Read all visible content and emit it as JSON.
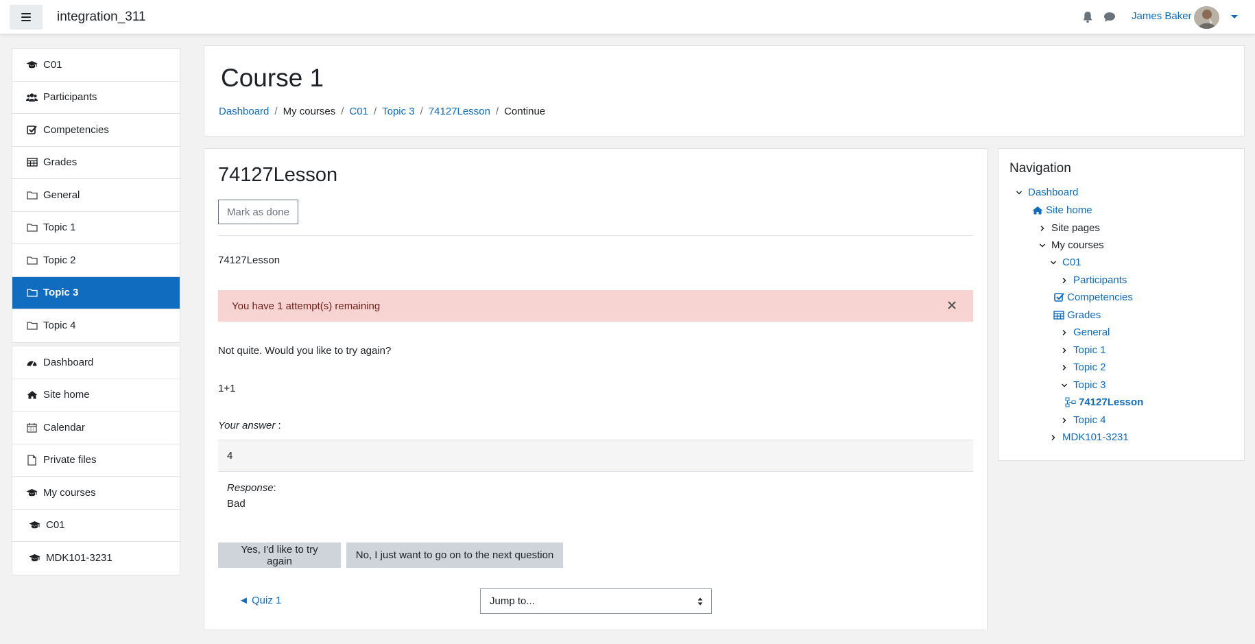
{
  "header": {
    "site_name": "integration_311",
    "user_name": "James Baker"
  },
  "drawer": {
    "course_items": [
      {
        "label": "C01",
        "icon": "graduation-cap-icon"
      },
      {
        "label": "Participants",
        "icon": "users-icon"
      },
      {
        "label": "Competencies",
        "icon": "check-square-icon"
      },
      {
        "label": "Grades",
        "icon": "table-icon"
      },
      {
        "label": "General",
        "icon": "folder-icon"
      },
      {
        "label": "Topic 1",
        "icon": "folder-icon"
      },
      {
        "label": "Topic 2",
        "icon": "folder-icon"
      },
      {
        "label": "Topic 3",
        "icon": "folder-icon",
        "active": true
      },
      {
        "label": "Topic 4",
        "icon": "folder-icon"
      }
    ],
    "site_items": [
      {
        "label": "Dashboard",
        "icon": "dashboard-icon"
      },
      {
        "label": "Site home",
        "icon": "home-icon"
      },
      {
        "label": "Calendar",
        "icon": "calendar-icon"
      },
      {
        "label": "Private files",
        "icon": "file-icon"
      },
      {
        "label": "My courses",
        "icon": "graduation-cap-icon"
      },
      {
        "label": "C01",
        "icon": "graduation-cap-icon"
      },
      {
        "label": "MDK101-3231",
        "icon": "graduation-cap-icon"
      }
    ]
  },
  "page": {
    "title": "Course 1",
    "breadcrumb": [
      {
        "label": "Dashboard",
        "link": true
      },
      {
        "label": "My courses",
        "link": false
      },
      {
        "label": "C01",
        "link": true
      },
      {
        "label": "Topic 3",
        "link": true
      },
      {
        "label": "74127Lesson",
        "link": true
      },
      {
        "label": "Continue",
        "link": false
      }
    ]
  },
  "lesson": {
    "title": "74127Lesson",
    "mark_done_label": "Mark as done",
    "intro": "74127Lesson",
    "alert": "You have 1 attempt(s) remaining",
    "feedback": "Not quite. Would you like to try again?",
    "question": "1+1",
    "your_answer_label": "Your answer",
    "your_answer_suffix": " :",
    "answer_value": "4",
    "response_label": "Response",
    "response_value": "Bad",
    "yes_button": "Yes, I'd like to try again",
    "no_button": "No, I just want to go on to the next question",
    "prev_link": "◄ Quiz 1",
    "jump_placeholder": "Jump to..."
  },
  "navigation": {
    "title": "Navigation",
    "tree": {
      "dashboard": "Dashboard",
      "site_home": "Site home",
      "site_pages": "Site pages",
      "my_courses": "My courses",
      "c01": "C01",
      "participants": "Participants",
      "competencies": "Competencies",
      "grades": "Grades",
      "general": "General",
      "topic1": "Topic 1",
      "topic2": "Topic 2",
      "topic3": "Topic 3",
      "lesson": "74127Lesson",
      "topic4": "Topic 4",
      "mdk": "MDK101-3231"
    }
  },
  "colors": {
    "brand": "#0f6cbf",
    "alert_bg": "#f7d4d1",
    "alert_text": "#6e211a",
    "secondary_button": "#ced4da"
  }
}
